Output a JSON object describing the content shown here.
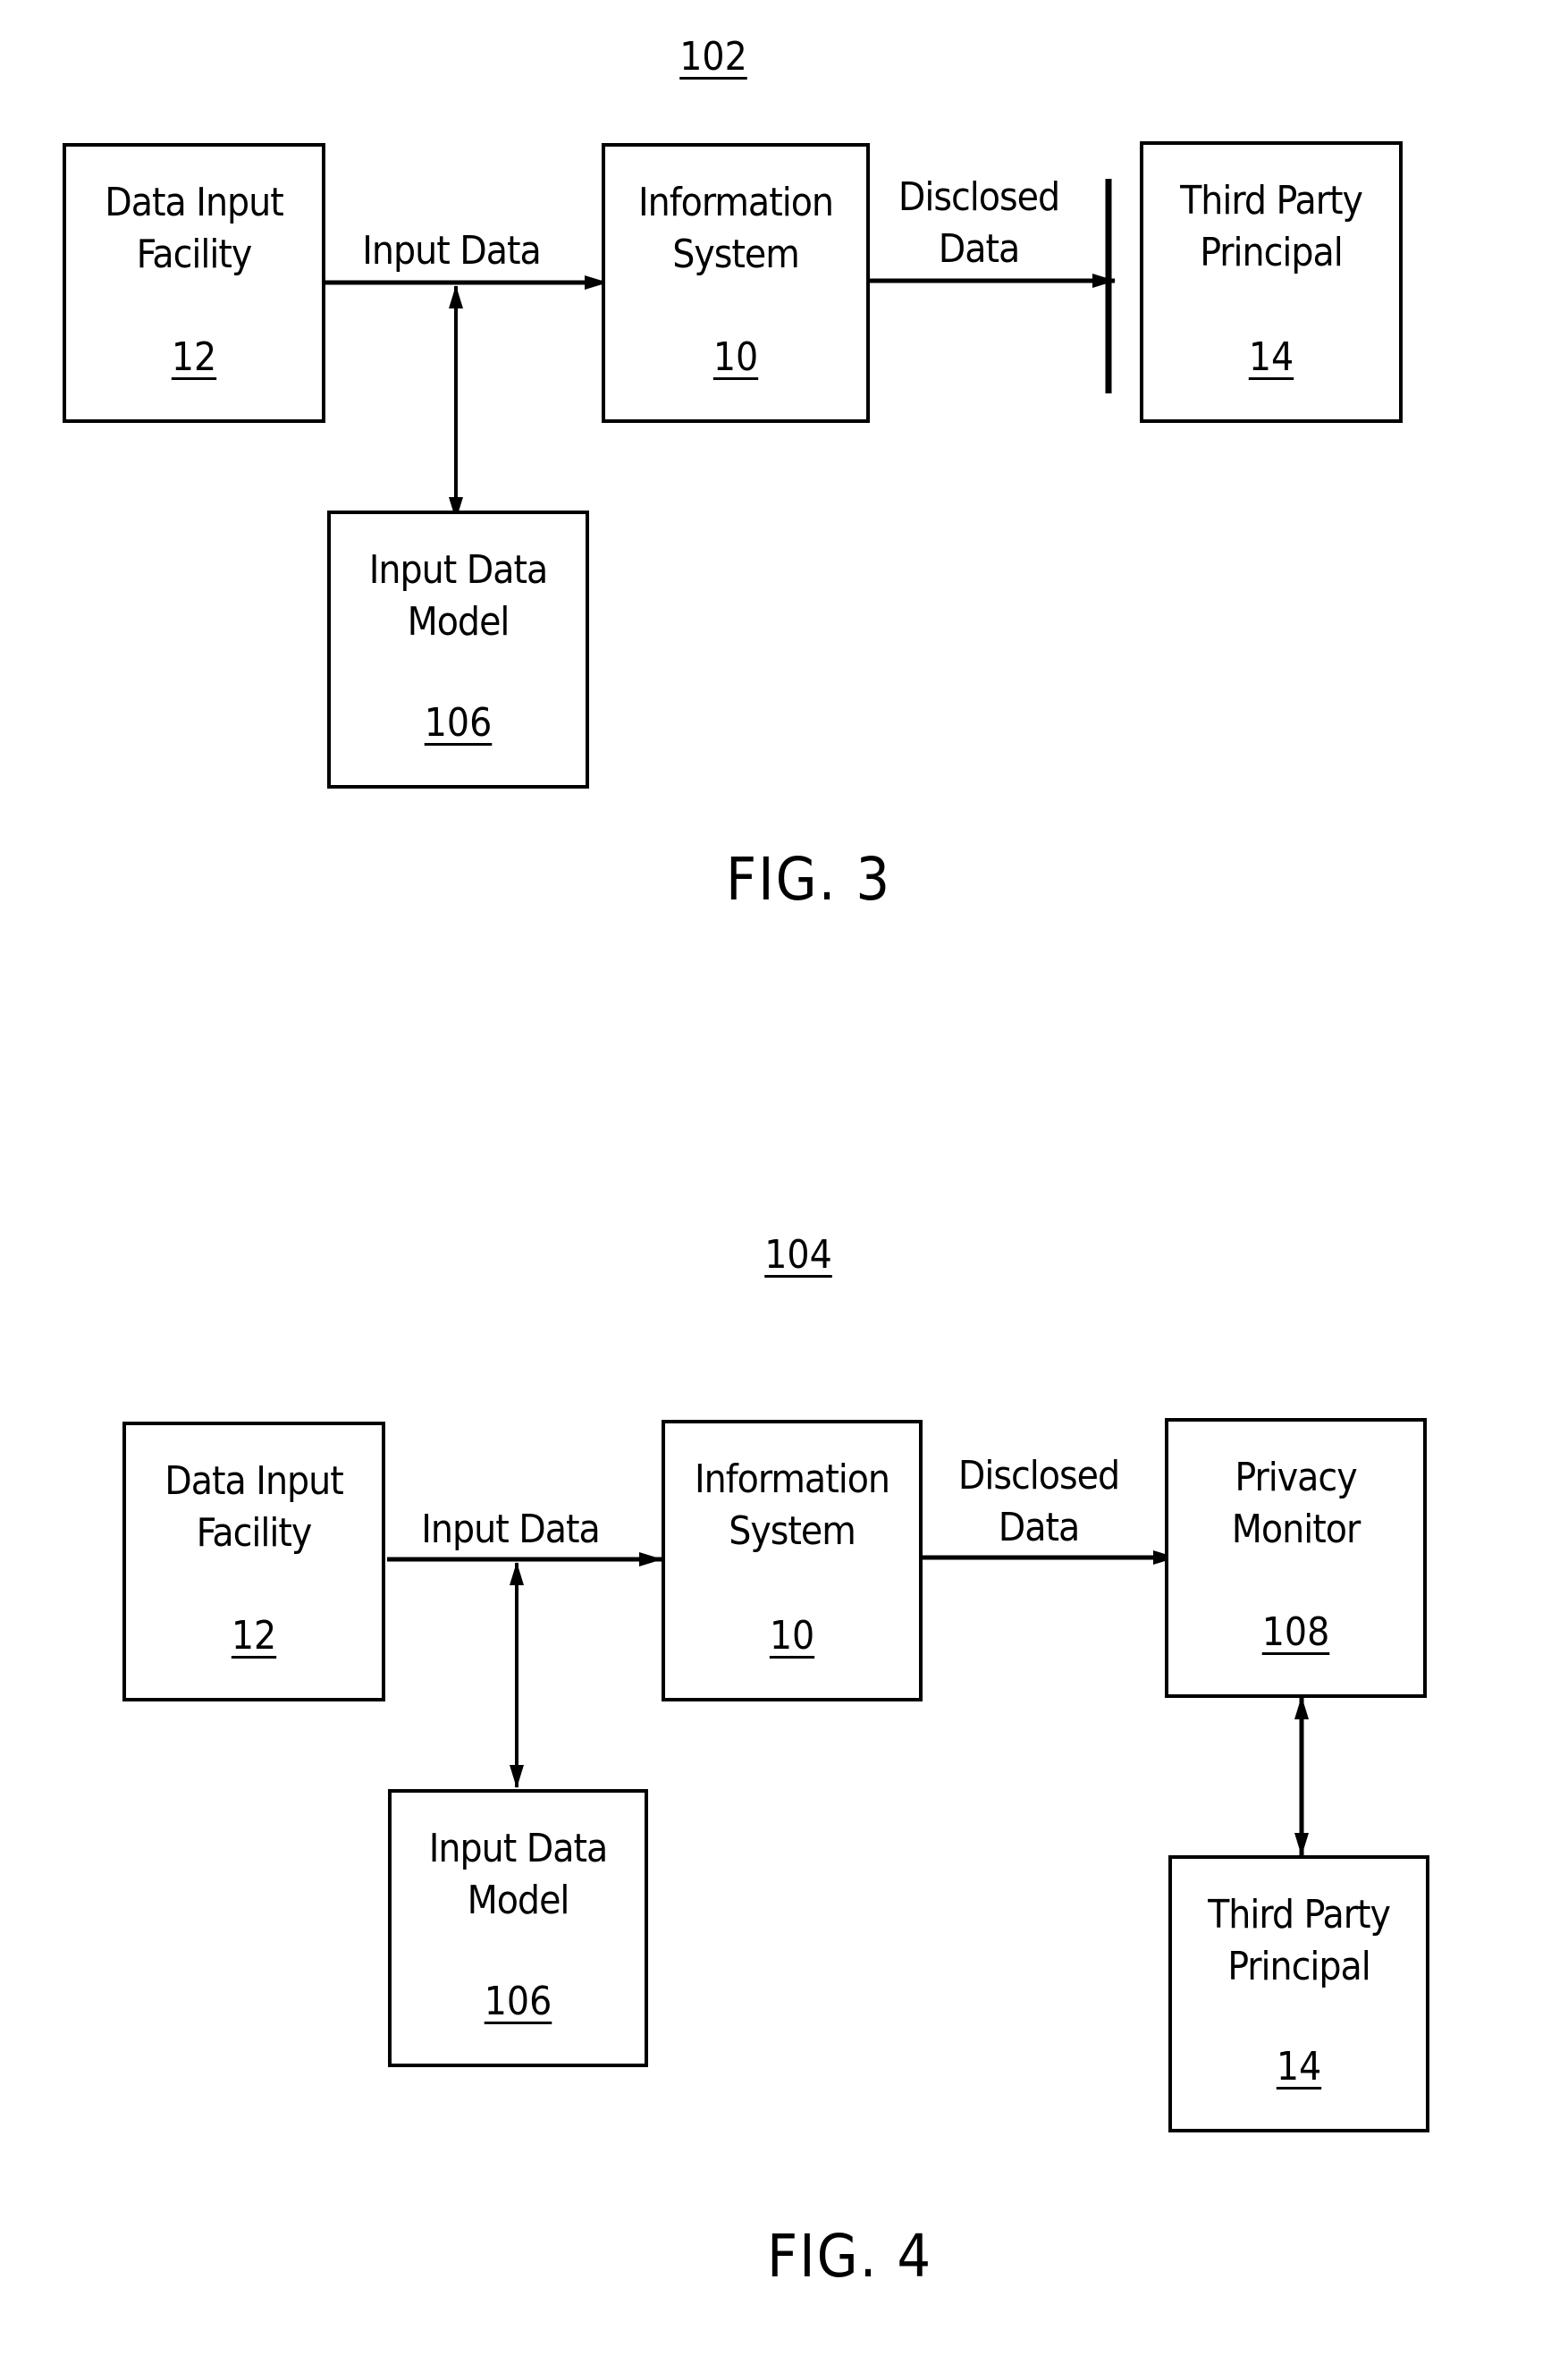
{
  "fig3": {
    "ref": "102",
    "caption": "FIG. 3",
    "boxes": {
      "data_input_facility": {
        "title": "Data Input Facility",
        "ref": "12"
      },
      "information_system": {
        "title": "Information System",
        "ref": "10"
      },
      "third_party_principal": {
        "title": "Third Party Principal",
        "ref": "14"
      },
      "input_data_model": {
        "title": "Input Data Model",
        "ref": "106"
      }
    },
    "edges": {
      "input_data": "Input Data",
      "disclosed_data": "Disclosed Data"
    }
  },
  "fig4": {
    "ref": "104",
    "caption": "FIG. 4",
    "boxes": {
      "data_input_facility": {
        "title": "Data Input Facility",
        "ref": "12"
      },
      "information_system": {
        "title": "Information System",
        "ref": "10"
      },
      "privacy_monitor": {
        "title": "Privacy Monitor",
        "ref": "108"
      },
      "input_data_model": {
        "title": "Input Data Model",
        "ref": "106"
      },
      "third_party_principal": {
        "title": "Third Party Principal",
        "ref": "14"
      }
    },
    "edges": {
      "input_data": "Input Data",
      "disclosed_data": "Disclosed Data"
    }
  }
}
